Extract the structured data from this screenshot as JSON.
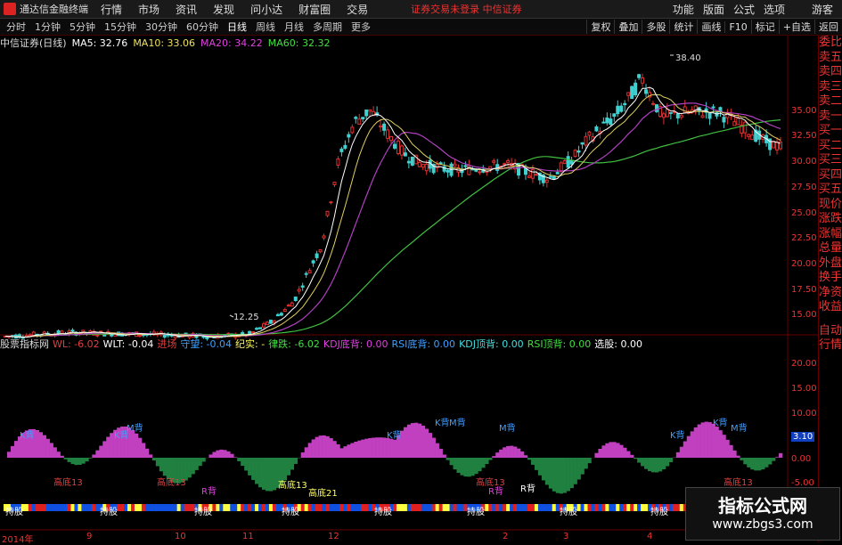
{
  "app": {
    "title": "通达信金融终端",
    "menu": [
      "行情",
      "市场",
      "资讯",
      "发现",
      "问小达",
      "财富圈",
      "交易"
    ],
    "broker_status": "证券交易未登录  中信证券",
    "right_menu": [
      "功能",
      "版面",
      "公式",
      "选项"
    ],
    "guest": "游客"
  },
  "periods": [
    "分时",
    "1分钟",
    "5分钟",
    "15分钟",
    "30分钟",
    "60分钟",
    "日线",
    "周线",
    "月线",
    "多周期",
    "更多"
  ],
  "active_period": "日线",
  "tools": [
    "复权",
    "叠加",
    "多股",
    "统计",
    "画线",
    "F10",
    "标记",
    "+自选",
    "返回"
  ],
  "stock": {
    "name": "中信证券(日线)",
    "ma": [
      {
        "label": "MA5: 32.76",
        "color": "#ffffff"
      },
      {
        "label": "MA10: 33.06",
        "color": "#f0e060"
      },
      {
        "label": "MA20: 34.22",
        "color": "#e040e0"
      },
      {
        "label": "MA60: 32.32",
        "color": "#40e040"
      }
    ]
  },
  "price_axis": [
    "35.00",
    "32.50",
    "30.00",
    "27.50",
    "25.00",
    "22.50",
    "20.00",
    "17.50",
    "15.00"
  ],
  "annotations": {
    "high": "38.40",
    "low": "12.25"
  },
  "indicator": {
    "name": "股票指标网",
    "items": [
      {
        "label": "WL: -6.02",
        "color": "#e04040"
      },
      {
        "label": "WLT: -0.04",
        "color": "#ffffff"
      },
      {
        "label": "进场",
        "color": "#e04040"
      },
      {
        "label": "守望: -0.04",
        "color": "#40a0ff"
      },
      {
        "label": "纪实: -",
        "color": "#ffff60"
      },
      {
        "label": "律跌: -6.02",
        "color": "#40e040"
      },
      {
        "label": "KDJ底背: 0.00",
        "color": "#e040e0"
      },
      {
        "label": "RSI底背: 0.00",
        "color": "#40a0ff"
      },
      {
        "label": "KDJ顶背: 0.00",
        "color": "#40e0e0"
      },
      {
        "label": "RSI顶背: 0.00",
        "color": "#40e040"
      },
      {
        "label": "选股: 0.00",
        "color": "#ffffff"
      }
    ],
    "axis": [
      "20.00",
      "15.00",
      "10.00",
      "5.00",
      "0.00",
      "-5.00"
    ],
    "current_value": "3.10",
    "labels": {
      "k_back": "K背",
      "m_back": "M背",
      "r_back": "R背",
      "high_bottom13": "高底13",
      "high_bottom21": "高底21",
      "hold": "持股"
    }
  },
  "dates": [
    "2014年",
    "9",
    "10",
    "11",
    "12",
    "2",
    "3",
    "4"
  ],
  "side_panel": [
    "委比",
    "卖五",
    "卖四",
    "卖三",
    "卖二",
    "卖一",
    "买一",
    "买二",
    "买三",
    "买四",
    "买五",
    "现价",
    "涨跌",
    "涨幅",
    "总量",
    "外盘",
    "换手",
    "净资",
    "收益"
  ],
  "side_bottom": [
    "自动",
    "行情"
  ],
  "watermark": {
    "title": "指标公式网",
    "url": "www.zbgs3.com"
  }
}
